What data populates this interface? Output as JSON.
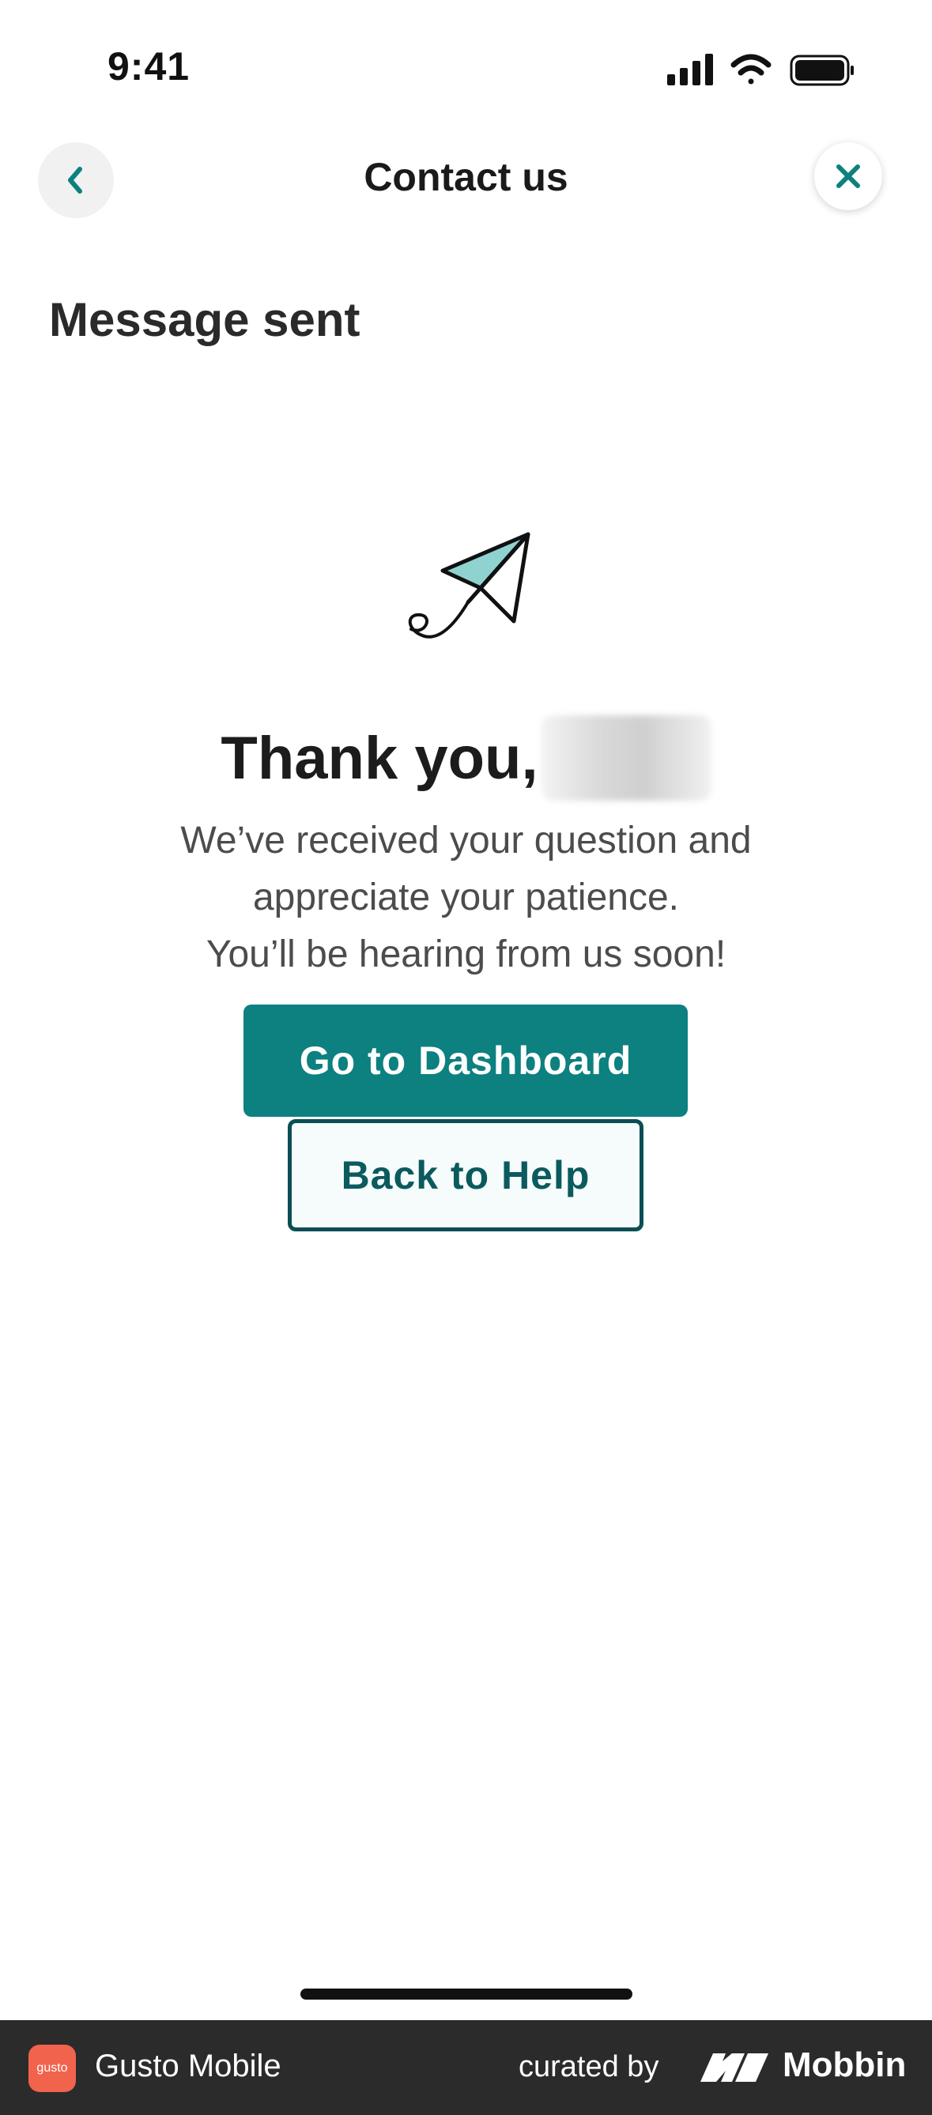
{
  "status_bar": {
    "time": "9:41"
  },
  "header": {
    "title": "Contact us"
  },
  "page": {
    "section_title": "Message sent"
  },
  "confirmation": {
    "heading": "Thank you,",
    "lines": [
      "We’ve received your question and",
      "appreciate your patience.",
      "You’ll be hearing from us soon!"
    ]
  },
  "actions": {
    "primary_label": "Go to Dashboard",
    "secondary_label": "Back to Help"
  },
  "footer": {
    "app_name": "Gusto Mobile",
    "logo_text": "gusto",
    "curated_by": "curated by",
    "brand": "Mobbin"
  },
  "colors": {
    "primary": "#0d8080",
    "secondary_border": "#0b4e55",
    "footer_bg": "#2b2b2b",
    "gusto_logo": "#f1634c"
  },
  "icons": [
    "back-chevron-icon",
    "close-icon",
    "paper-plane-icon",
    "cellular-icon",
    "wifi-icon",
    "battery-icon"
  ]
}
